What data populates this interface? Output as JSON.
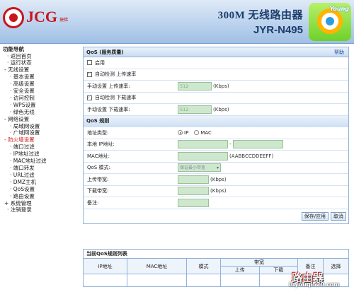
{
  "header": {
    "brand": "JCG",
    "brand_sub": "捷稀",
    "product_name": "300M 无线路由器",
    "model": "JYR-N495",
    "badge_text": "Young"
  },
  "sidebar": {
    "title": "功能导航",
    "items": [
      {
        "label": "· 返回首页",
        "level": "l1"
      },
      {
        "label": "· 运行状态",
        "level": "l1"
      },
      {
        "label": "- 无线设置",
        "level": "sec"
      },
      {
        "label": "· 基本设置",
        "level": "l2"
      },
      {
        "label": "· 高级设置",
        "level": "l2"
      },
      {
        "label": "· 安全设置",
        "level": "l2"
      },
      {
        "label": "· 访问控制",
        "level": "l2"
      },
      {
        "label": "· WPS设置",
        "level": "l2"
      },
      {
        "label": "· 绿色无线",
        "level": "l2"
      },
      {
        "label": "- 网络设置",
        "level": "sec"
      },
      {
        "label": "· 局域网设置",
        "level": "l2"
      },
      {
        "label": "· 广域网设置",
        "level": "l2"
      },
      {
        "label": "- 防火墙设置",
        "level": "sec",
        "active": true
      },
      {
        "label": "· 端口过滤",
        "level": "l2"
      },
      {
        "label": "· IP地址过滤",
        "level": "l2"
      },
      {
        "label": "· MAC地址过滤",
        "level": "l2"
      },
      {
        "label": "· 端口转发",
        "level": "l2"
      },
      {
        "label": "· URL过滤",
        "level": "l2"
      },
      {
        "label": "· DMZ主机",
        "level": "l2"
      },
      {
        "label": "· QoS设置",
        "level": "l2"
      },
      {
        "label": "· 路由设置",
        "level": "l2"
      },
      {
        "label": "+ 系统管理",
        "level": "sec"
      },
      {
        "label": "· 注销登录",
        "level": "l1"
      }
    ]
  },
  "qos": {
    "title": "QoS (服务质量)",
    "help": "帮助",
    "enable_label": "启用",
    "auto_up_label": "自动检测 上传速率",
    "manual_up_label": "手动设置 上传速率:",
    "manual_up_value": "512",
    "auto_down_label": "自动检测 下载速率",
    "manual_down_label": "手动设置 下载速率:",
    "manual_down_value": "512",
    "unit": "(Kbps)"
  },
  "rule": {
    "title": "QoS 规则",
    "addr_type_label": "地址类型:",
    "opt_ip": "IP",
    "opt_mac": "MAC",
    "local_ip_label": "本地  IP地址:",
    "dash": "-",
    "mac_label": "MAC地址:",
    "mac_hint": "(AABBCCDDEEFF)",
    "mode_label": "QoS 模式:",
    "mode_value": "保证最小带宽",
    "up_bw_label": "上传带宽:",
    "down_bw_label": "下载带宽:",
    "unit": "(Kbps)",
    "note_label": "备注:",
    "save_btn": "保存/应用",
    "cancel_btn": "取消"
  },
  "list": {
    "caption": "当前QoS规则列表",
    "col_ip": "IP地址",
    "col_mac": "MAC地址",
    "col_mode": "模式",
    "col_bw": "带宽",
    "col_up": "上传",
    "col_down": "下载",
    "col_note": "备注",
    "col_select": "选择"
  },
  "watermark": {
    "title": "路由器",
    "url": "luyouqi520.com"
  }
}
